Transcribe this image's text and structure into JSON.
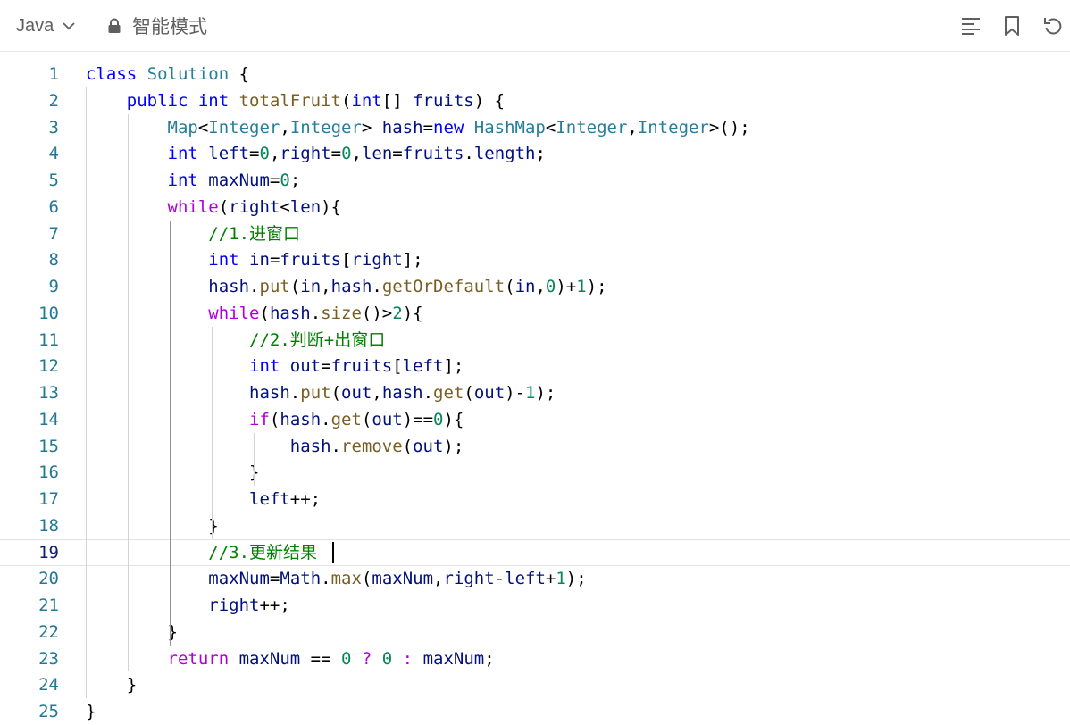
{
  "toolbar": {
    "language": "Java",
    "mode_label": "智能模式",
    "icons": {
      "chevron": "chevron-down-icon",
      "lock": "lock-icon",
      "format": "align-left-icon",
      "bookmark": "bookmark-icon",
      "reset": "undo-icon"
    }
  },
  "editor": {
    "current_line": 19,
    "lines": [
      {
        "n": "1",
        "tokens": [
          [
            "class ",
            "kw"
          ],
          [
            "Solution",
            "ty"
          ],
          [
            " {",
            ""
          ]
        ]
      },
      {
        "n": "2",
        "tokens": [
          [
            "    ",
            ""
          ],
          [
            "public ",
            "kw"
          ],
          [
            "int ",
            "kw"
          ],
          [
            "totalFruit",
            "fn"
          ],
          [
            "(",
            ""
          ],
          [
            "int",
            "kw"
          ],
          [
            "[] ",
            ""
          ],
          [
            "fruits",
            "vr"
          ],
          [
            ") {",
            ""
          ]
        ]
      },
      {
        "n": "3",
        "tokens": [
          [
            "        ",
            ""
          ],
          [
            "Map",
            "ty"
          ],
          [
            "<",
            ""
          ],
          [
            "Integer",
            "ty"
          ],
          [
            ",",
            ""
          ],
          [
            "Integer",
            "ty"
          ],
          [
            "> ",
            ""
          ],
          [
            "hash",
            "vr"
          ],
          [
            "=",
            ""
          ],
          [
            "new ",
            "kw"
          ],
          [
            "HashMap",
            "ty"
          ],
          [
            "<",
            ""
          ],
          [
            "Integer",
            "ty"
          ],
          [
            ",",
            ""
          ],
          [
            "Integer",
            "ty"
          ],
          [
            ">();",
            ""
          ]
        ]
      },
      {
        "n": "4",
        "tokens": [
          [
            "        ",
            ""
          ],
          [
            "int ",
            "kw"
          ],
          [
            "left",
            "vr"
          ],
          [
            "=",
            ""
          ],
          [
            "0",
            "nu"
          ],
          [
            ",",
            ""
          ],
          [
            "right",
            "vr"
          ],
          [
            "=",
            ""
          ],
          [
            "0",
            "nu"
          ],
          [
            ",",
            ""
          ],
          [
            "len",
            "vr"
          ],
          [
            "=",
            ""
          ],
          [
            "fruits",
            "vr"
          ],
          [
            ".",
            ""
          ],
          [
            "length",
            "vr"
          ],
          [
            ";",
            ""
          ]
        ]
      },
      {
        "n": "5",
        "tokens": [
          [
            "        ",
            ""
          ],
          [
            "int ",
            "kw"
          ],
          [
            "maxNum",
            "vr"
          ],
          [
            "=",
            ""
          ],
          [
            "0",
            "nu"
          ],
          [
            ";",
            ""
          ]
        ]
      },
      {
        "n": "6",
        "tokens": [
          [
            "        ",
            ""
          ],
          [
            "while",
            "ct"
          ],
          [
            "(",
            ""
          ],
          [
            "right",
            "vr"
          ],
          [
            "<",
            ""
          ],
          [
            "len",
            "vr"
          ],
          [
            "){",
            ""
          ]
        ]
      },
      {
        "n": "7",
        "tokens": [
          [
            "            ",
            ""
          ],
          [
            "//1.进窗口",
            "cm"
          ]
        ]
      },
      {
        "n": "8",
        "tokens": [
          [
            "            ",
            ""
          ],
          [
            "int ",
            "kw"
          ],
          [
            "in",
            "vr"
          ],
          [
            "=",
            ""
          ],
          [
            "fruits",
            "vr"
          ],
          [
            "[",
            ""
          ],
          [
            "right",
            "vr"
          ],
          [
            "];",
            ""
          ]
        ]
      },
      {
        "n": "9",
        "tokens": [
          [
            "            ",
            ""
          ],
          [
            "hash",
            "vr"
          ],
          [
            ".",
            ""
          ],
          [
            "put",
            "fn"
          ],
          [
            "(",
            ""
          ],
          [
            "in",
            "vr"
          ],
          [
            ",",
            ""
          ],
          [
            "hash",
            "vr"
          ],
          [
            ".",
            ""
          ],
          [
            "getOrDefault",
            "fn"
          ],
          [
            "(",
            ""
          ],
          [
            "in",
            "vr"
          ],
          [
            ",",
            ""
          ],
          [
            "0",
            "nu"
          ],
          [
            ")+",
            ""
          ],
          [
            "1",
            "nu"
          ],
          [
            ");",
            ""
          ]
        ]
      },
      {
        "n": "10",
        "tokens": [
          [
            "            ",
            ""
          ],
          [
            "while",
            "ct"
          ],
          [
            "(",
            ""
          ],
          [
            "hash",
            "vr"
          ],
          [
            ".",
            ""
          ],
          [
            "size",
            "fn"
          ],
          [
            "()>",
            ""
          ],
          [
            "2",
            "nu"
          ],
          [
            "){",
            ""
          ]
        ]
      },
      {
        "n": "11",
        "tokens": [
          [
            "                ",
            ""
          ],
          [
            "//2.判断+出窗口",
            "cm"
          ]
        ]
      },
      {
        "n": "12",
        "tokens": [
          [
            "                ",
            ""
          ],
          [
            "int ",
            "kw"
          ],
          [
            "out",
            "vr"
          ],
          [
            "=",
            ""
          ],
          [
            "fruits",
            "vr"
          ],
          [
            "[",
            ""
          ],
          [
            "left",
            "vr"
          ],
          [
            "];",
            ""
          ]
        ]
      },
      {
        "n": "13",
        "tokens": [
          [
            "                ",
            ""
          ],
          [
            "hash",
            "vr"
          ],
          [
            ".",
            ""
          ],
          [
            "put",
            "fn"
          ],
          [
            "(",
            ""
          ],
          [
            "out",
            "vr"
          ],
          [
            ",",
            ""
          ],
          [
            "hash",
            "vr"
          ],
          [
            ".",
            ""
          ],
          [
            "get",
            "fn"
          ],
          [
            "(",
            ""
          ],
          [
            "out",
            "vr"
          ],
          [
            ")-",
            ""
          ],
          [
            "1",
            "nu"
          ],
          [
            ");",
            ""
          ]
        ]
      },
      {
        "n": "14",
        "tokens": [
          [
            "                ",
            ""
          ],
          [
            "if",
            "ct"
          ],
          [
            "(",
            ""
          ],
          [
            "hash",
            "vr"
          ],
          [
            ".",
            ""
          ],
          [
            "get",
            "fn"
          ],
          [
            "(",
            ""
          ],
          [
            "out",
            "vr"
          ],
          [
            ")==",
            ""
          ],
          [
            "0",
            "nu"
          ],
          [
            "){",
            ""
          ]
        ]
      },
      {
        "n": "15",
        "tokens": [
          [
            "                    ",
            ""
          ],
          [
            "hash",
            "vr"
          ],
          [
            ".",
            ""
          ],
          [
            "remove",
            "fn"
          ],
          [
            "(",
            ""
          ],
          [
            "out",
            "vr"
          ],
          [
            ");",
            ""
          ]
        ]
      },
      {
        "n": "16",
        "tokens": [
          [
            "                }",
            ""
          ]
        ]
      },
      {
        "n": "17",
        "tokens": [
          [
            "                ",
            ""
          ],
          [
            "left",
            "vr"
          ],
          [
            "++;",
            ""
          ]
        ]
      },
      {
        "n": "18",
        "tokens": [
          [
            "            }",
            ""
          ]
        ]
      },
      {
        "n": "19",
        "tokens": [
          [
            "            ",
            ""
          ],
          [
            "//3.更新结果",
            "cm"
          ]
        ]
      },
      {
        "n": "20",
        "tokens": [
          [
            "            ",
            ""
          ],
          [
            "maxNum",
            "vr"
          ],
          [
            "=",
            ""
          ],
          [
            "Math",
            "vr"
          ],
          [
            ".",
            ""
          ],
          [
            "max",
            "fn"
          ],
          [
            "(",
            ""
          ],
          [
            "maxNum",
            "vr"
          ],
          [
            ",",
            ""
          ],
          [
            "right",
            "vr"
          ],
          [
            "-",
            ""
          ],
          [
            "left",
            "vr"
          ],
          [
            "+",
            ""
          ],
          [
            "1",
            "nu"
          ],
          [
            ");",
            ""
          ]
        ]
      },
      {
        "n": "21",
        "tokens": [
          [
            "            ",
            ""
          ],
          [
            "right",
            "vr"
          ],
          [
            "++;",
            ""
          ]
        ]
      },
      {
        "n": "22",
        "tokens": [
          [
            "        }",
            ""
          ]
        ]
      },
      {
        "n": "23",
        "tokens": [
          [
            "        ",
            ""
          ],
          [
            "return ",
            "ct"
          ],
          [
            "maxNum ",
            "vr"
          ],
          [
            "== ",
            ""
          ],
          [
            "0 ",
            "nu"
          ],
          [
            "? ",
            "ct"
          ],
          [
            "0 ",
            "nu"
          ],
          [
            ": ",
            "ct"
          ],
          [
            "maxNum",
            "vr"
          ],
          [
            ";",
            ""
          ]
        ]
      },
      {
        "n": "24",
        "tokens": [
          [
            "    }",
            ""
          ]
        ]
      },
      {
        "n": "25",
        "tokens": [
          [
            "}",
            ""
          ]
        ]
      }
    ]
  }
}
